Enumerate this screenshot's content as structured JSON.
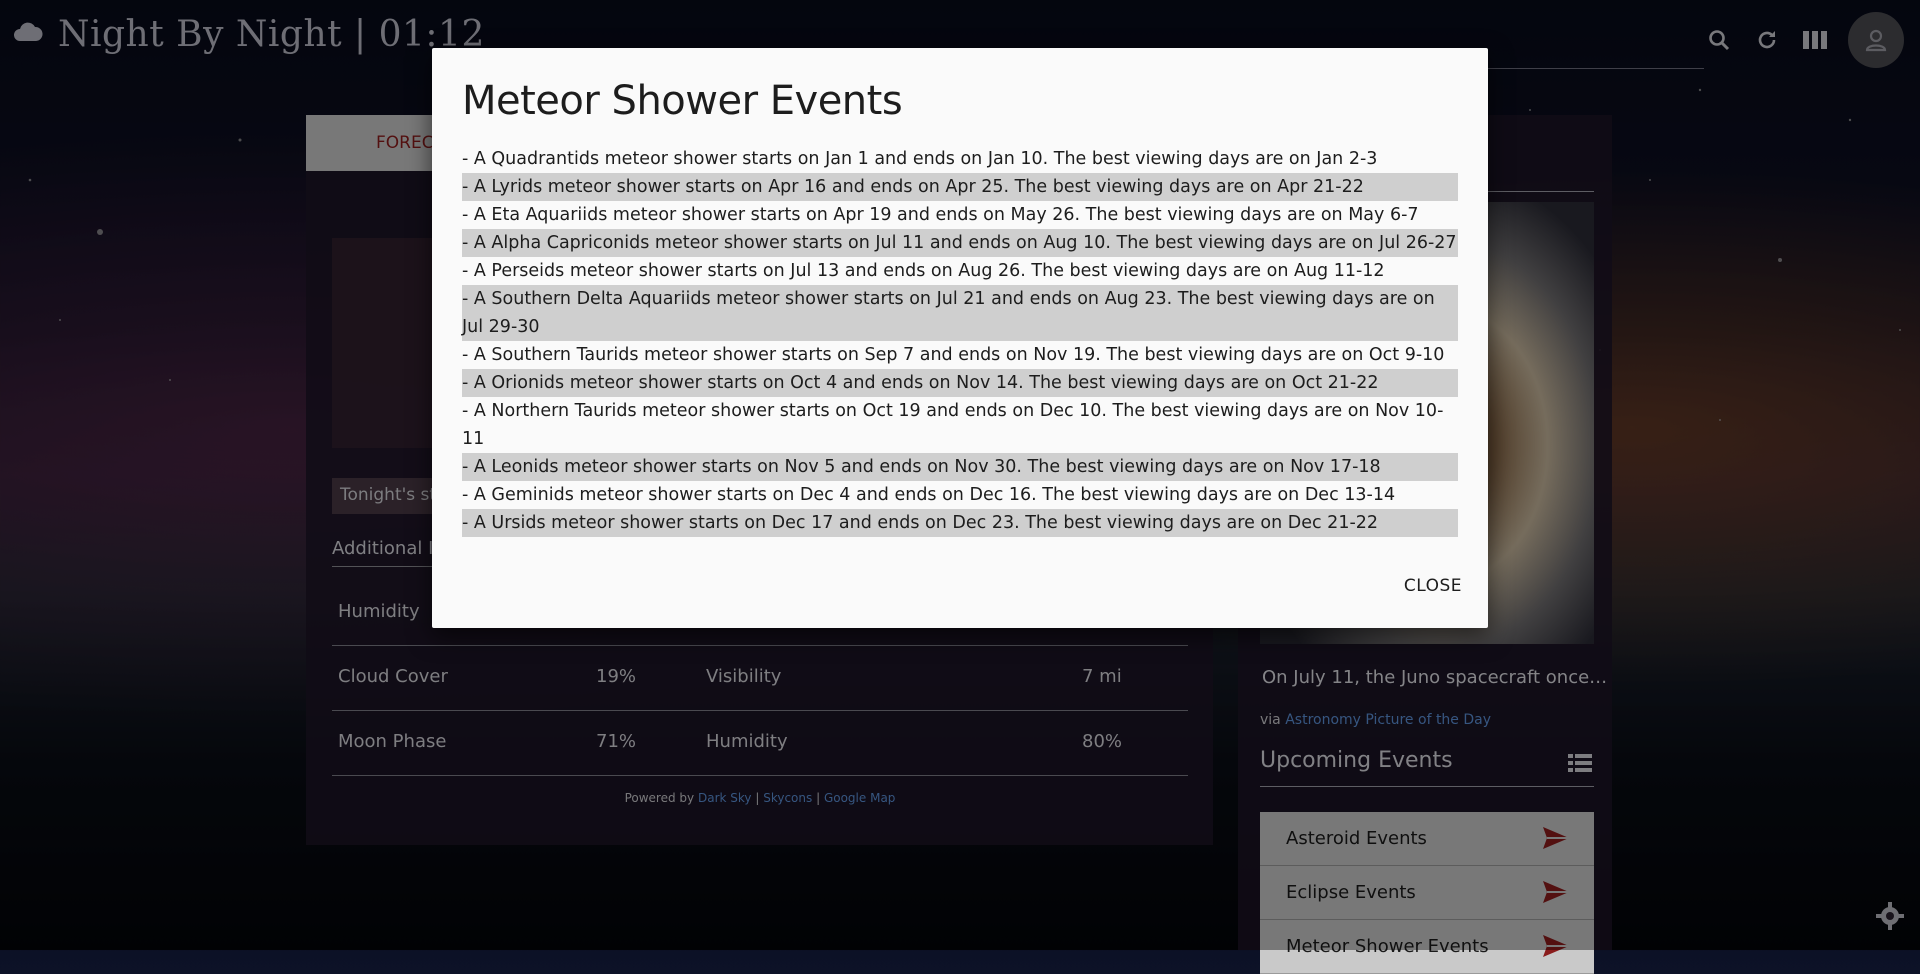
{
  "app": {
    "title": "Night By Night | 01:12"
  },
  "main": {
    "tab_forecast": "FOREC",
    "tonight_label": "Tonight's st",
    "additional_info_label": "Additional In",
    "weather_rows": [
      {
        "label": "Humidity",
        "value": "",
        "label2": "",
        "value2": ""
      },
      {
        "label": "Cloud Cover",
        "value": "19%",
        "label2": "Visibility",
        "value2": "7 mi"
      },
      {
        "label": "Moon Phase",
        "value": "71%",
        "label2": "Humidity",
        "value2": "80%"
      }
    ],
    "powered_prefix": "Powered by",
    "powered_links": [
      "Dark Sky",
      "Skycons",
      "Google Map"
    ],
    "separator": "|"
  },
  "sidebar": {
    "apod_caption": "On July 11, the Juno spacecraft once…",
    "via_prefix": "via",
    "via_link": "Astronomy Picture of the Day",
    "upcoming_title": "Upcoming Events",
    "events": [
      {
        "label": "Asteroid Events"
      },
      {
        "label": "Eclipse Events"
      },
      {
        "label": "Meteor Shower Events"
      }
    ]
  },
  "modal": {
    "title": "Meteor Shower Events",
    "events": [
      "- A Quadrantids meteor shower starts on Jan 1 and ends on Jan 10. The best viewing days are on Jan 2-3",
      "- A Lyrids meteor shower starts on Apr 16 and ends on Apr 25. The best viewing days are on Apr 21-22",
      "- A Eta Aquariids meteor shower starts on Apr 19 and ends on May 26. The best viewing days are on May 6-7",
      "- A Alpha Capriconids meteor shower starts on Jul 11 and ends on Aug 10. The best viewing days are on Jul 26-27",
      "- A Perseids meteor shower starts on Jul 13 and ends on Aug 26. The best viewing days are on Aug 11-12",
      "- A Southern Delta Aquariids meteor shower starts on Jul 21 and ends on Aug 23. The best viewing days are on Jul 29-30",
      "- A Southern Taurids meteor shower starts on Sep 7 and ends on Nov 19. The best viewing days are on Oct 9-10",
      "- A Orionids meteor shower starts on Oct 4 and ends on Nov 14. The best viewing days are on Oct 21-22",
      "- A Northern Taurids meteor shower starts on Oct 19 and ends on Dec 10. The best viewing days are on Nov 10-11",
      "- A Leonids meteor shower starts on Nov 5 and ends on Nov 30. The best viewing days are on Nov 17-18",
      "- A Geminids meteor shower starts on Dec 4 and ends on Dec 16. The best viewing days are on Dec 13-14",
      "- A Ursids meteor shower starts on Dec 17 and ends on Dec 23. The best viewing days are on Dec 21-22"
    ],
    "close_label": "CLOSE"
  },
  "colors": {
    "accent_red": "#8a1c1c",
    "link_blue": "#5b8fd6",
    "modal_bg": "#fafafa",
    "row_alt": "#cfcfcf"
  },
  "icons": {
    "brand": "cloud-icon",
    "search": "search-icon",
    "refresh": "refresh-icon",
    "layout": "columns-icon",
    "user": "person-icon",
    "list": "list-icon",
    "send": "send-arrow-icon",
    "settings": "gear-icon"
  }
}
